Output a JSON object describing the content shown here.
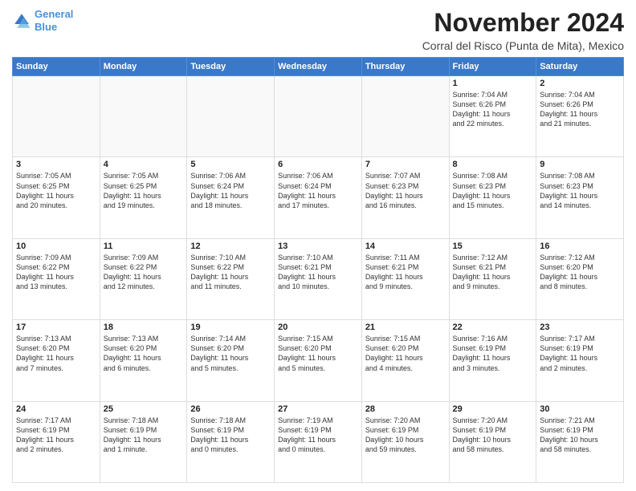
{
  "logo": {
    "line1": "General",
    "line2": "Blue"
  },
  "title": "November 2024",
  "subtitle": "Corral del Risco (Punta de Mita), Mexico",
  "weekdays": [
    "Sunday",
    "Monday",
    "Tuesday",
    "Wednesday",
    "Thursday",
    "Friday",
    "Saturday"
  ],
  "weeks": [
    [
      {
        "day": "",
        "info": ""
      },
      {
        "day": "",
        "info": ""
      },
      {
        "day": "",
        "info": ""
      },
      {
        "day": "",
        "info": ""
      },
      {
        "day": "",
        "info": ""
      },
      {
        "day": "1",
        "info": "Sunrise: 7:04 AM\nSunset: 6:26 PM\nDaylight: 11 hours\nand 22 minutes."
      },
      {
        "day": "2",
        "info": "Sunrise: 7:04 AM\nSunset: 6:26 PM\nDaylight: 11 hours\nand 21 minutes."
      }
    ],
    [
      {
        "day": "3",
        "info": "Sunrise: 7:05 AM\nSunset: 6:25 PM\nDaylight: 11 hours\nand 20 minutes."
      },
      {
        "day": "4",
        "info": "Sunrise: 7:05 AM\nSunset: 6:25 PM\nDaylight: 11 hours\nand 19 minutes."
      },
      {
        "day": "5",
        "info": "Sunrise: 7:06 AM\nSunset: 6:24 PM\nDaylight: 11 hours\nand 18 minutes."
      },
      {
        "day": "6",
        "info": "Sunrise: 7:06 AM\nSunset: 6:24 PM\nDaylight: 11 hours\nand 17 minutes."
      },
      {
        "day": "7",
        "info": "Sunrise: 7:07 AM\nSunset: 6:23 PM\nDaylight: 11 hours\nand 16 minutes."
      },
      {
        "day": "8",
        "info": "Sunrise: 7:08 AM\nSunset: 6:23 PM\nDaylight: 11 hours\nand 15 minutes."
      },
      {
        "day": "9",
        "info": "Sunrise: 7:08 AM\nSunset: 6:23 PM\nDaylight: 11 hours\nand 14 minutes."
      }
    ],
    [
      {
        "day": "10",
        "info": "Sunrise: 7:09 AM\nSunset: 6:22 PM\nDaylight: 11 hours\nand 13 minutes."
      },
      {
        "day": "11",
        "info": "Sunrise: 7:09 AM\nSunset: 6:22 PM\nDaylight: 11 hours\nand 12 minutes."
      },
      {
        "day": "12",
        "info": "Sunrise: 7:10 AM\nSunset: 6:22 PM\nDaylight: 11 hours\nand 11 minutes."
      },
      {
        "day": "13",
        "info": "Sunrise: 7:10 AM\nSunset: 6:21 PM\nDaylight: 11 hours\nand 10 minutes."
      },
      {
        "day": "14",
        "info": "Sunrise: 7:11 AM\nSunset: 6:21 PM\nDaylight: 11 hours\nand 9 minutes."
      },
      {
        "day": "15",
        "info": "Sunrise: 7:12 AM\nSunset: 6:21 PM\nDaylight: 11 hours\nand 9 minutes."
      },
      {
        "day": "16",
        "info": "Sunrise: 7:12 AM\nSunset: 6:20 PM\nDaylight: 11 hours\nand 8 minutes."
      }
    ],
    [
      {
        "day": "17",
        "info": "Sunrise: 7:13 AM\nSunset: 6:20 PM\nDaylight: 11 hours\nand 7 minutes."
      },
      {
        "day": "18",
        "info": "Sunrise: 7:13 AM\nSunset: 6:20 PM\nDaylight: 11 hours\nand 6 minutes."
      },
      {
        "day": "19",
        "info": "Sunrise: 7:14 AM\nSunset: 6:20 PM\nDaylight: 11 hours\nand 5 minutes."
      },
      {
        "day": "20",
        "info": "Sunrise: 7:15 AM\nSunset: 6:20 PM\nDaylight: 11 hours\nand 5 minutes."
      },
      {
        "day": "21",
        "info": "Sunrise: 7:15 AM\nSunset: 6:20 PM\nDaylight: 11 hours\nand 4 minutes."
      },
      {
        "day": "22",
        "info": "Sunrise: 7:16 AM\nSunset: 6:19 PM\nDaylight: 11 hours\nand 3 minutes."
      },
      {
        "day": "23",
        "info": "Sunrise: 7:17 AM\nSunset: 6:19 PM\nDaylight: 11 hours\nand 2 minutes."
      }
    ],
    [
      {
        "day": "24",
        "info": "Sunrise: 7:17 AM\nSunset: 6:19 PM\nDaylight: 11 hours\nand 2 minutes."
      },
      {
        "day": "25",
        "info": "Sunrise: 7:18 AM\nSunset: 6:19 PM\nDaylight: 11 hours\nand 1 minute."
      },
      {
        "day": "26",
        "info": "Sunrise: 7:18 AM\nSunset: 6:19 PM\nDaylight: 11 hours\nand 0 minutes."
      },
      {
        "day": "27",
        "info": "Sunrise: 7:19 AM\nSunset: 6:19 PM\nDaylight: 11 hours\nand 0 minutes."
      },
      {
        "day": "28",
        "info": "Sunrise: 7:20 AM\nSunset: 6:19 PM\nDaylight: 10 hours\nand 59 minutes."
      },
      {
        "day": "29",
        "info": "Sunrise: 7:20 AM\nSunset: 6:19 PM\nDaylight: 10 hours\nand 58 minutes."
      },
      {
        "day": "30",
        "info": "Sunrise: 7:21 AM\nSunset: 6:19 PM\nDaylight: 10 hours\nand 58 minutes."
      }
    ]
  ]
}
